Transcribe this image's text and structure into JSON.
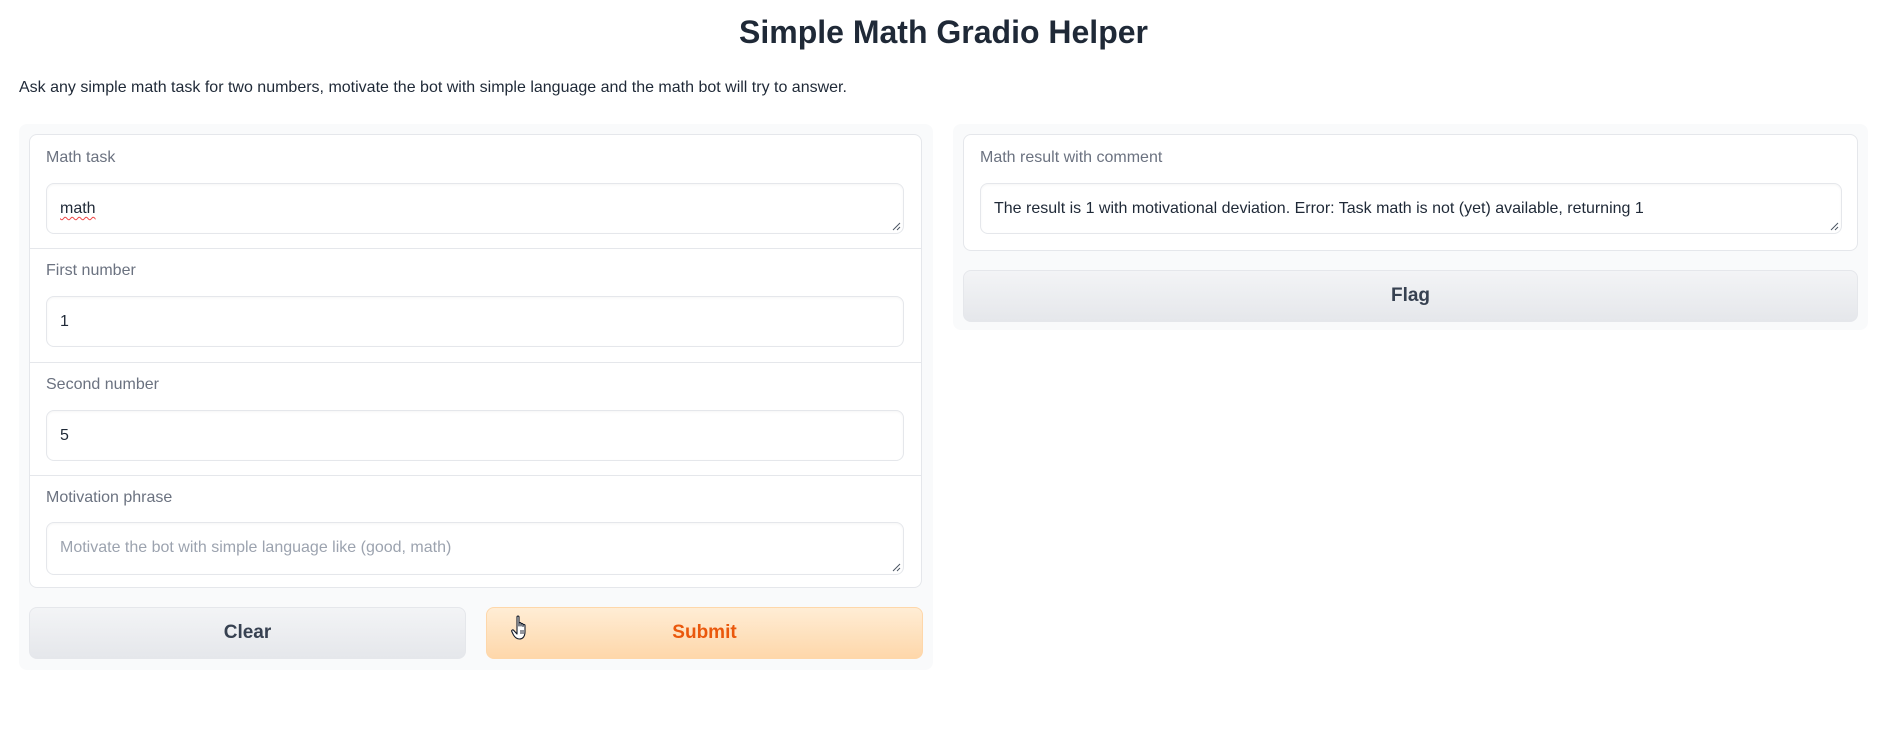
{
  "app": {
    "title": "Simple Math Gradio Helper",
    "description": "Ask any simple math task for two numbers, motivate the bot with simple language and the math bot will try to answer."
  },
  "inputs": {
    "math_task": {
      "label": "Math task",
      "value": "math"
    },
    "first_number": {
      "label": "First number",
      "value": "1"
    },
    "second_number": {
      "label": "Second number",
      "value": "5"
    },
    "motivation_phrase": {
      "label": "Motivation phrase",
      "value": "",
      "placeholder": "Motivate the bot with simple language like (good, math)"
    }
  },
  "buttons": {
    "clear_label": "Clear",
    "submit_label": "Submit",
    "flag_label": "Flag"
  },
  "output": {
    "label": "Math result with comment",
    "value": "The result is 1 with motivational deviation.  Error: Task math is not (yet) available, returning 1"
  },
  "colors": {
    "primary_accent": "#ea580c",
    "primary_bg": "#fed7aa",
    "secondary_bg": "#e5e7eb",
    "text": "#1f2937",
    "label": "#6b7280"
  },
  "icons": {
    "cursor": "hand-pointer-icon",
    "resize": "resize-grip-icon"
  }
}
